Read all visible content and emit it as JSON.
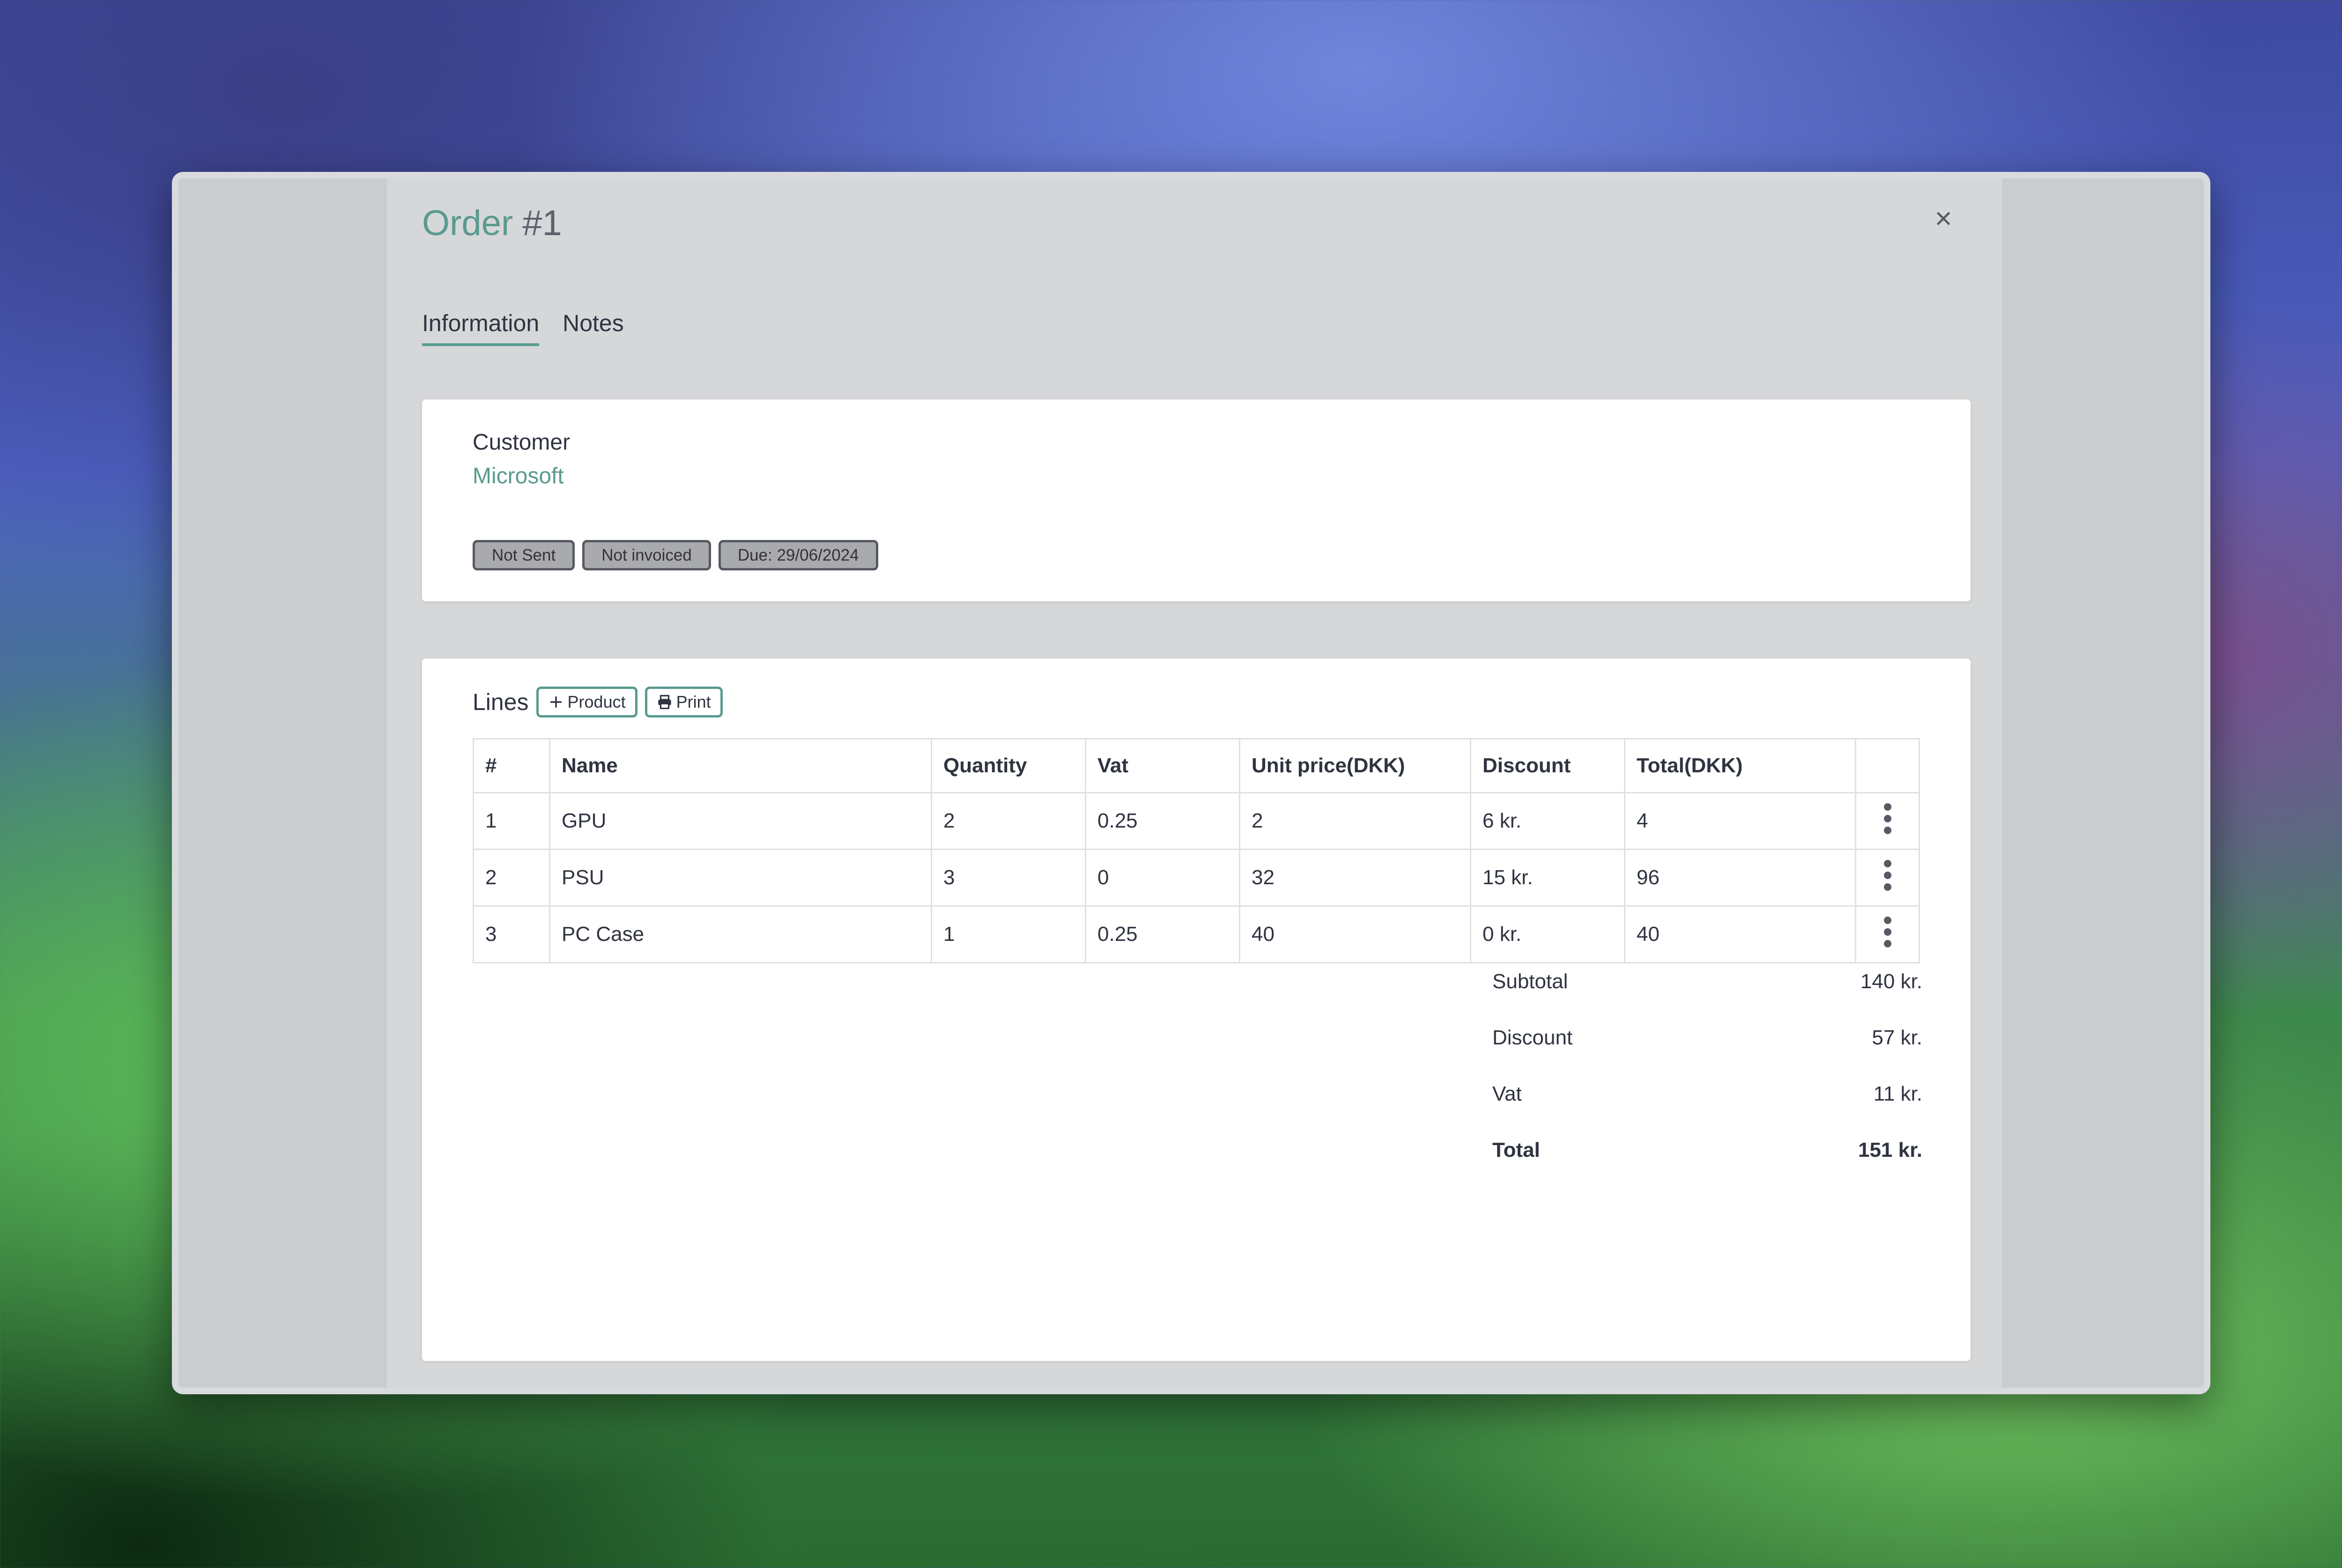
{
  "modal": {
    "title_word": "Order",
    "title_number": "#1",
    "close_symbol": "×"
  },
  "tabs": [
    {
      "label": "Information",
      "active": true
    },
    {
      "label": "Notes",
      "active": false
    }
  ],
  "customer": {
    "label": "Customer",
    "name": "Microsoft",
    "badges": [
      "Not Sent",
      "Not invoiced",
      "Due: 29/06/2024"
    ]
  },
  "lines": {
    "title": "Lines",
    "add_product_label": "Product",
    "print_label": "Print",
    "columns": [
      "#",
      "Name",
      "Quantity",
      "Vat",
      "Unit price(DKK)",
      "Discount",
      "Total(DKK)",
      ""
    ],
    "rows": [
      {
        "num": "1",
        "name": "GPU",
        "quantity": "2",
        "vat": "0.25",
        "unit_price": "2",
        "discount": "6 kr.",
        "total": "4"
      },
      {
        "num": "2",
        "name": "PSU",
        "quantity": "3",
        "vat": "0",
        "unit_price": "32",
        "discount": "15 kr.",
        "total": "96"
      },
      {
        "num": "3",
        "name": "PC Case",
        "quantity": "1",
        "vat": "0.25",
        "unit_price": "40",
        "discount": "0 kr.",
        "total": "40"
      }
    ]
  },
  "summary": {
    "subtotal_label": "Subtotal",
    "subtotal_value": "140 kr.",
    "discount_label": "Discount",
    "discount_value": "57 kr.",
    "vat_label": "Vat",
    "vat_value": "11 kr.",
    "total_label": "Total",
    "total_value": "151 kr."
  },
  "colors": {
    "accent": "#5a9a8f",
    "badge_bg": "#a9aaad",
    "modal_bg": "#d6d7d9"
  },
  "icons": {
    "close": "close-icon",
    "add": "plus-icon",
    "print": "printer-icon",
    "row_menu": "kebab-menu-icon"
  }
}
